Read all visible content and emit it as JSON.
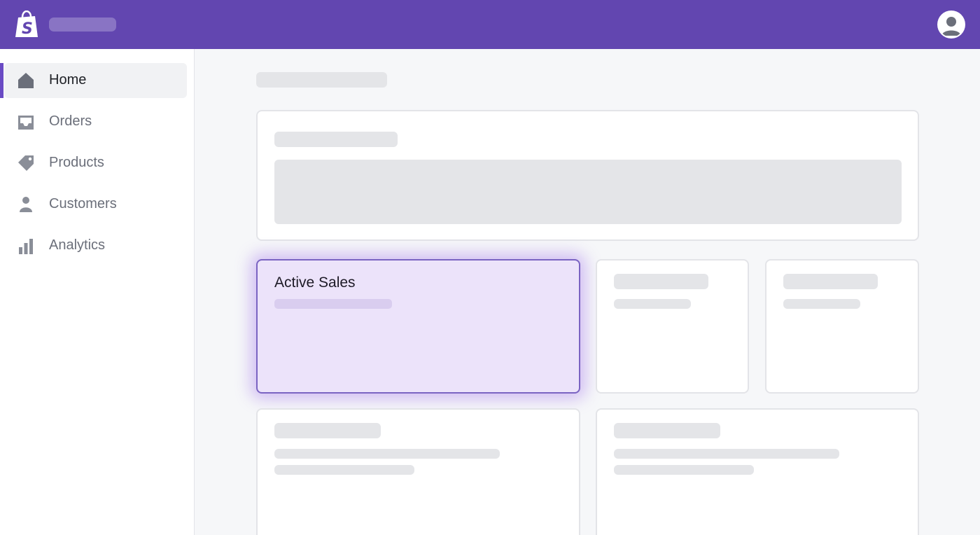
{
  "brand": {
    "logo_icon": "shopify-bag-icon",
    "colors": {
      "topbar": "#6246b0",
      "accent": "#6a4bc4",
      "highlight_bg": "#ece3fa"
    }
  },
  "topbar": {
    "avatar_icon": "user-avatar-icon"
  },
  "sidebar": {
    "items": [
      {
        "label": "Home",
        "icon": "home-icon",
        "active": true
      },
      {
        "label": "Orders",
        "icon": "inbox-icon",
        "active": false
      },
      {
        "label": "Products",
        "icon": "tag-icon",
        "active": false
      },
      {
        "label": "Customers",
        "icon": "person-icon",
        "active": false
      },
      {
        "label": "Analytics",
        "icon": "bar-chart-icon",
        "active": false
      }
    ]
  },
  "main": {
    "highlight_card": {
      "title": "Active Sales"
    }
  }
}
